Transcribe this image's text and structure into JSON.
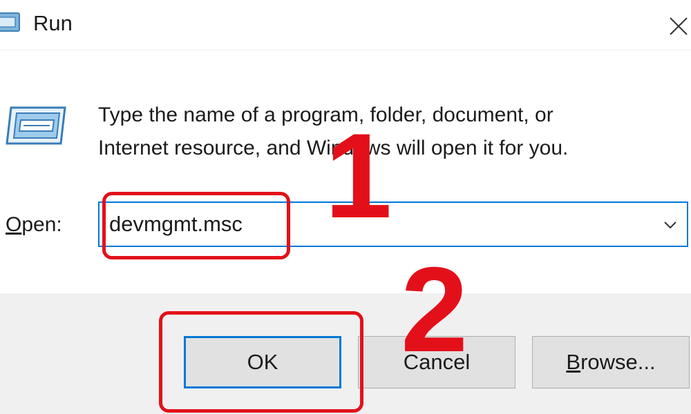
{
  "window": {
    "title": "Run",
    "close_icon": "close-icon"
  },
  "body": {
    "icon": "run-icon",
    "description_line1": "Type the name of a program, folder, document, or",
    "description_line2": "Internet resource, and Windows will open it for you.",
    "open_label_accel": "O",
    "open_label_rest": "pen:",
    "open_value": "devmgmt.msc",
    "dropdown_icon": "chevron-down-icon"
  },
  "buttons": {
    "ok_label": "OK",
    "cancel_label": "Cancel",
    "browse_accel": "B",
    "browse_rest": "rowse..."
  },
  "annotations": {
    "step1": "1",
    "step2": "2",
    "color": "#e3101a"
  },
  "colors": {
    "accent": "#0078d7",
    "button_face": "#e1e1e1",
    "button_strip": "#f0f0f0",
    "annotation": "#e3101a"
  }
}
